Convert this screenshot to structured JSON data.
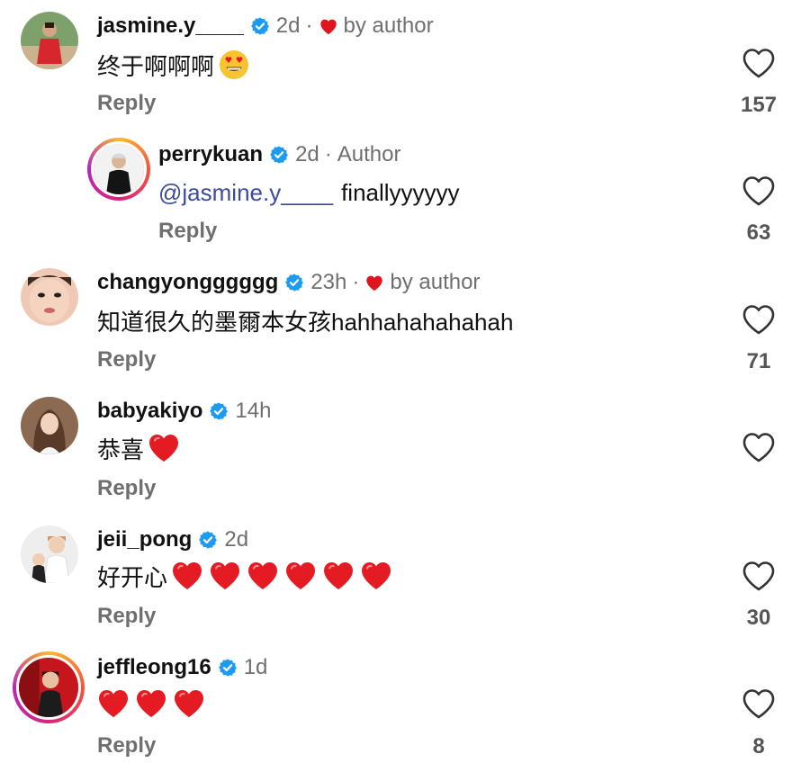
{
  "colors": {
    "verified_blue": "#1d9bf0",
    "author_heart": "#e0141e",
    "mention": "#3c4b9b",
    "meta_gray": "#6f6f6f"
  },
  "comments": [
    {
      "username": "jasmine.y____",
      "time": "2d",
      "badge": "by author",
      "text": "终于啊啊啊",
      "emoji": "heart-eyes-face",
      "reply_label": "Reply",
      "likes": "157"
    },
    {
      "username": "perrykuan",
      "time": "2d",
      "badge": "Author",
      "mention": "@jasmine.y____",
      "text": "finallyyyyyy",
      "reply_label": "Reply",
      "likes": "63"
    },
    {
      "username": "changyongggggg",
      "time": "23h",
      "badge": "by author",
      "text": "知道很久的墨爾本女孩hahhahahahahah",
      "reply_label": "Reply",
      "likes": "71"
    },
    {
      "username": "babyakiyo",
      "time": "14h",
      "text": "恭喜",
      "emoji_hearts": 1,
      "reply_label": "Reply",
      "likes": ""
    },
    {
      "username": "jeii_pong",
      "time": "2d",
      "text": "好开心",
      "emoji_hearts": 6,
      "reply_label": "Reply",
      "likes": "30"
    },
    {
      "username": "jeffleong16",
      "time": "1d",
      "text": "",
      "emoji_hearts": 3,
      "reply_label": "Reply",
      "likes": "8"
    }
  ],
  "separator": "·"
}
